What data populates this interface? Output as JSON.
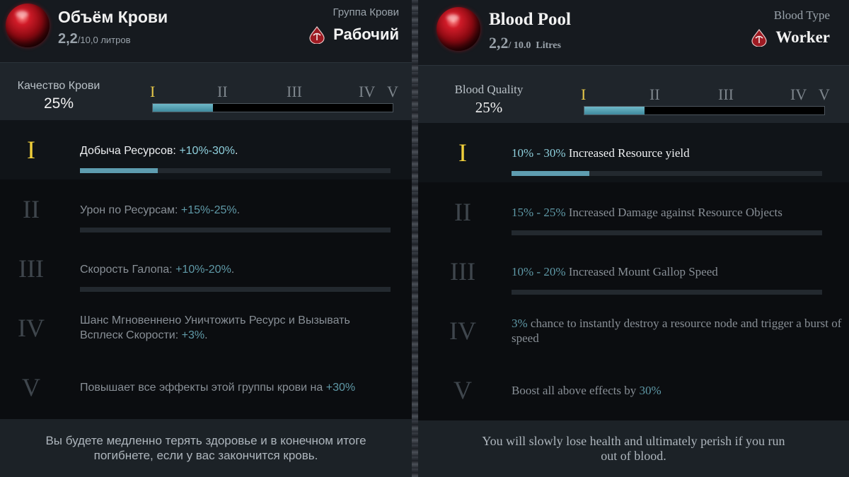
{
  "ru": {
    "title": "Объём Крови",
    "amount_current": "2,2",
    "amount_rest": "/10,0 литров",
    "blood_type_label": "Группа Крови",
    "blood_type_value": "Рабочий",
    "quality_label": "Качество Крови",
    "quality_value": "25%",
    "quality_fraction": 0.25,
    "numerals": [
      "I",
      "II",
      "III",
      "IV",
      "V"
    ],
    "tiers": [
      {
        "numeral": "I",
        "text": "Добыча Ресурсов: ",
        "value": "+10%-30%",
        "suffix": ".",
        "progress": 0.25
      },
      {
        "numeral": "II",
        "text": "Урон по Ресурсам: ",
        "value": "+15%-25%",
        "suffix": ".",
        "progress": 0
      },
      {
        "numeral": "III",
        "text": "Скорость Галопа: ",
        "value": "+10%-20%",
        "suffix": ".",
        "progress": 0
      },
      {
        "numeral": "IV",
        "text": "Шанс Мгновеннено Уничтожить Ресурс и Вызывать Всплеск Скорости: ",
        "value": "+3%",
        "suffix": "."
      },
      {
        "numeral": "V",
        "text": "Повышает все эффекты этой группы крови на ",
        "value": "+30%",
        "suffix": ""
      }
    ],
    "footer": "Вы будете медленно терять здоровье и в конечном итоге погибнете, если у вас закончится кровь."
  },
  "en": {
    "title": "Blood Pool",
    "amount_current": "2,2",
    "amount_rest": "/ 10.0  Litres",
    "blood_type_label": "Blood Type",
    "blood_type_value": "Worker",
    "quality_label": "Blood Quality",
    "quality_value": "25%",
    "quality_fraction": 0.25,
    "numerals": [
      "I",
      "II",
      "III",
      "IV",
      "V"
    ],
    "tiers": [
      {
        "numeral": "I",
        "value": "10% - 30%",
        "text": " Increased Resource yield",
        "progress": 0.25
      },
      {
        "numeral": "II",
        "value": "15% - 25%",
        "text": " Increased Damage against Resource Objects",
        "progress": 0
      },
      {
        "numeral": "III",
        "value": "10% - 20%",
        "text": " Increased Mount Gallop Speed",
        "progress": 0
      },
      {
        "numeral": "IV",
        "value": "3%",
        "text": " chance to instantly destroy a resource node and trigger a burst of speed"
      },
      {
        "numeral": "V",
        "prefix": "Boost all above effects by ",
        "value": "30%",
        "text": ""
      }
    ],
    "footer": "You will slowly lose health and ultimately perish if you run out of blood."
  },
  "colors": {
    "active_numeral": "#f0cf3b",
    "value_accent": "#5f99a7",
    "bar_fill": "#5e9db0",
    "orb": "#d01b28"
  },
  "icons": {
    "blood_orb": "blood-orb-icon",
    "blood_type": "blood-drop-pickaxe-icon"
  }
}
